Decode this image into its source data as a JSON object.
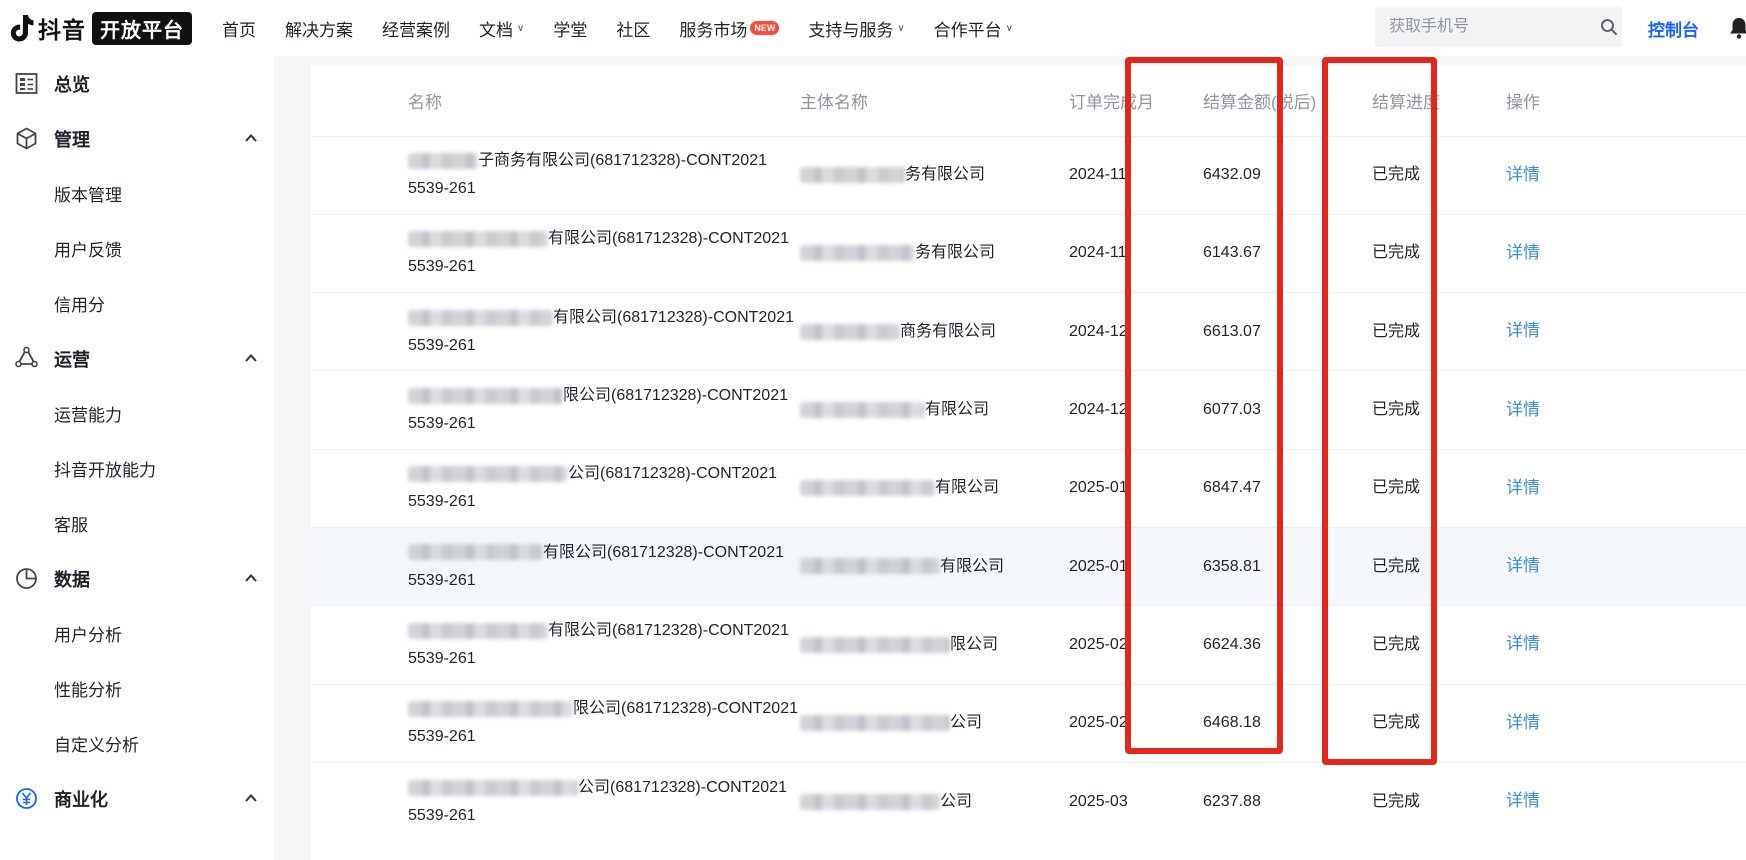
{
  "header": {
    "logo_text": "抖音",
    "logo_pill": "开放平台",
    "nav": [
      {
        "label": "首页",
        "dropdown": false
      },
      {
        "label": "解决方案",
        "dropdown": false
      },
      {
        "label": "经营案例",
        "dropdown": false
      },
      {
        "label": "文档",
        "dropdown": true
      },
      {
        "label": "学堂",
        "dropdown": false
      },
      {
        "label": "社区",
        "dropdown": false
      },
      {
        "label": "服务市场",
        "dropdown": false,
        "badge": "NEW"
      },
      {
        "label": "支持与服务",
        "dropdown": true
      },
      {
        "label": "合作平台",
        "dropdown": true
      }
    ],
    "search_placeholder": "获取手机号",
    "console_label": "控制台"
  },
  "sidebar": {
    "groups": [
      {
        "label": "总览",
        "icon": "dashboard-icon",
        "expanded": null,
        "items": []
      },
      {
        "label": "管理",
        "icon": "cube-icon",
        "expanded": true,
        "items": [
          "版本管理",
          "用户反馈",
          "信用分"
        ]
      },
      {
        "label": "运营",
        "icon": "operations-icon",
        "expanded": true,
        "items": [
          "运营能力",
          "抖音开放能力",
          "客服"
        ]
      },
      {
        "label": "数据",
        "icon": "pie-chart-icon",
        "expanded": true,
        "items": [
          "用户分析",
          "性能分析",
          "自定义分析"
        ]
      },
      {
        "label": "商业化",
        "icon": "yen-icon",
        "expanded": true,
        "items": []
      }
    ]
  },
  "table": {
    "columns": [
      "名称",
      "主体名称",
      "订单完成月",
      "结算金额(税后)",
      "结算进度",
      "操作"
    ],
    "rows": [
      {
        "name_visible": "子商务有限公司(681712328)-CONT2021",
        "name_line2": "5539-261",
        "entity_visible": "务有限公司",
        "month": "2024-11",
        "amount": "6432.09",
        "status": "已完成",
        "action": "详情"
      },
      {
        "name_visible": "有限公司(681712328)-CONT2021",
        "name_line2": "5539-261",
        "entity_visible": "务有限公司",
        "month": "2024-11",
        "amount": "6143.67",
        "status": "已完成",
        "action": "详情"
      },
      {
        "name_visible": "有限公司(681712328)-CONT2021",
        "name_line2": "5539-261",
        "entity_visible": "商务有限公司",
        "month": "2024-12",
        "amount": "6613.07",
        "status": "已完成",
        "action": "详情"
      },
      {
        "name_visible": "限公司(681712328)-CONT2021",
        "name_line2": "5539-261",
        "entity_visible": "有限公司",
        "month": "2024-12",
        "amount": "6077.03",
        "status": "已完成",
        "action": "详情"
      },
      {
        "name_visible": "公司(681712328)-CONT2021",
        "name_line2": "5539-261",
        "entity_visible": "有限公司",
        "month": "2025-01",
        "amount": "6847.47",
        "status": "已完成",
        "action": "详情"
      },
      {
        "name_visible": "有限公司(681712328)-CONT2021",
        "name_line2": "5539-261",
        "entity_visible": "有限公司",
        "month": "2025-01",
        "amount": "6358.81",
        "status": "已完成",
        "action": "详情"
      },
      {
        "name_visible": "有限公司(681712328)-CONT2021",
        "name_line2": "5539-261",
        "entity_visible": "限公司",
        "month": "2025-02",
        "amount": "6624.36",
        "status": "已完成",
        "action": "详情"
      },
      {
        "name_visible": "限公司(681712328)-CONT2021",
        "name_line2": "5539-261",
        "entity_visible": "公司",
        "month": "2025-02",
        "amount": "6468.18",
        "status": "已完成",
        "action": "详情"
      },
      {
        "name_visible": "公司(681712328)-CONT2021",
        "name_line2": "5539-261",
        "entity_visible": "公司",
        "month": "2025-03",
        "amount": "6237.88",
        "status": "已完成",
        "action": "详情"
      }
    ]
  },
  "colors": {
    "brand": "#1664ff",
    "link": "#3a8fd6",
    "annotation_red": "#e3281b",
    "badge_red": "#fe4a3b"
  }
}
